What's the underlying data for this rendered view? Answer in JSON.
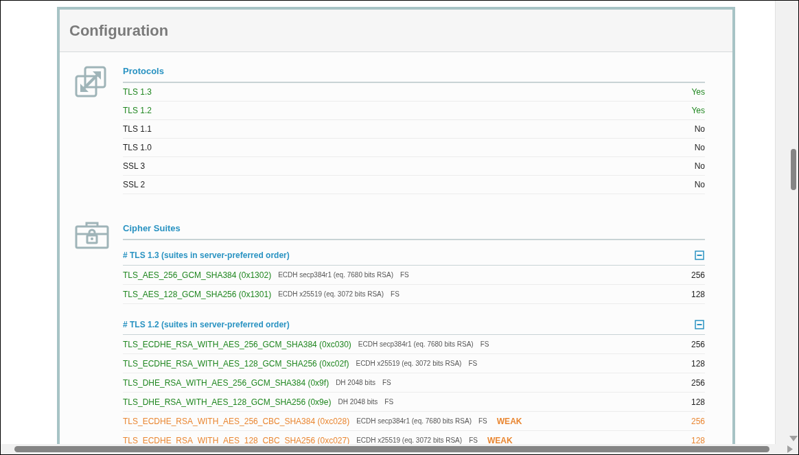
{
  "panel": {
    "title": "Configuration"
  },
  "protocols": {
    "title": "Protocols",
    "rows": [
      {
        "name": "TLS 1.3",
        "value": "Yes",
        "enabled": true
      },
      {
        "name": "TLS 1.2",
        "value": "Yes",
        "enabled": true
      },
      {
        "name": "TLS 1.1",
        "value": "No",
        "enabled": false
      },
      {
        "name": "TLS 1.0",
        "value": "No",
        "enabled": false
      },
      {
        "name": "SSL 3",
        "value": "No",
        "enabled": false
      },
      {
        "name": "SSL 2",
        "value": "No",
        "enabled": false
      }
    ]
  },
  "cipher_suites": {
    "title": "Cipher Suites",
    "groups": [
      {
        "heading": "# TLS 1.3 (suites in server-preferred order)",
        "expanded": true,
        "suites": [
          {
            "name": "TLS_AES_256_GCM_SHA384",
            "code": "(0x1302)",
            "kex": "ECDH secp384r1 (eq. 7680 bits RSA)",
            "fs": "FS",
            "weak": false,
            "bits": "256"
          },
          {
            "name": "TLS_AES_128_GCM_SHA256",
            "code": "(0x1301)",
            "kex": "ECDH x25519 (eq. 3072 bits RSA)",
            "fs": "FS",
            "weak": false,
            "bits": "128"
          }
        ]
      },
      {
        "heading": "# TLS 1.2 (suites in server-preferred order)",
        "expanded": true,
        "suites": [
          {
            "name": "TLS_ECDHE_RSA_WITH_AES_256_GCM_SHA384",
            "code": "(0xc030)",
            "kex": "ECDH secp384r1 (eq. 7680 bits RSA)",
            "fs": "FS",
            "weak": false,
            "bits": "256"
          },
          {
            "name": "TLS_ECDHE_RSA_WITH_AES_128_GCM_SHA256",
            "code": "(0xc02f)",
            "kex": "ECDH x25519 (eq. 3072 bits RSA)",
            "fs": "FS",
            "weak": false,
            "bits": "128"
          },
          {
            "name": "TLS_DHE_RSA_WITH_AES_256_GCM_SHA384",
            "code": "(0x9f)",
            "kex": "DH 2048 bits",
            "fs": "FS",
            "weak": false,
            "bits": "256"
          },
          {
            "name": "TLS_DHE_RSA_WITH_AES_128_GCM_SHA256",
            "code": "(0x9e)",
            "kex": "DH 2048 bits",
            "fs": "FS",
            "weak": false,
            "bits": "128"
          },
          {
            "name": "TLS_ECDHE_RSA_WITH_AES_256_CBC_SHA384",
            "code": "(0xc028)",
            "kex": "ECDH secp384r1 (eq. 7680 bits RSA)",
            "fs": "FS",
            "weak": true,
            "weak_label": "WEAK",
            "bits": "256"
          },
          {
            "name": "TLS_ECDHE_RSA_WITH_AES_128_CBC_SHA256",
            "code": "(0xc027)",
            "kex": "ECDH x25519 (eq. 3072 bits RSA)",
            "fs": "FS",
            "weak": true,
            "weak_label": "WEAK",
            "bits": "128"
          }
        ]
      }
    ]
  }
}
